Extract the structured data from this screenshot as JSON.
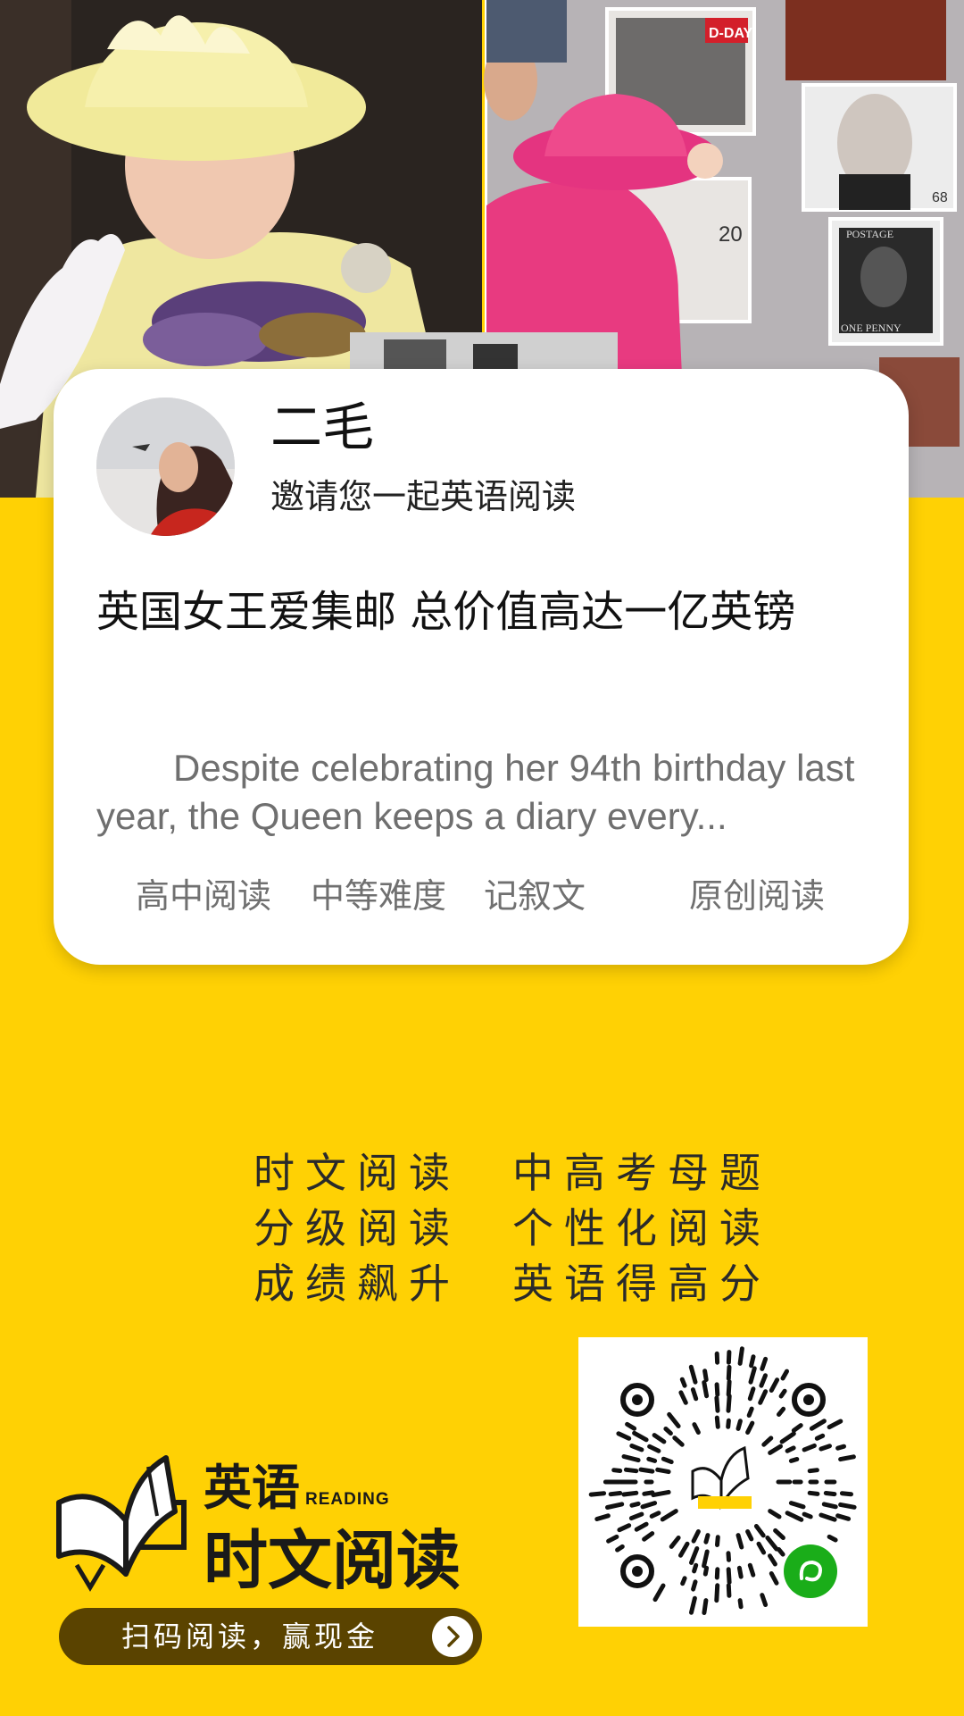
{
  "invite_card": {
    "username": "二毛",
    "invite_text": "邀请您一起英语阅读",
    "article_title": "英国女王爱集邮 总价值高达一亿英镑",
    "excerpt": "Despite celebrating her 94th birthday last year, the Queen keeps a diary every...",
    "tags": [
      "高中阅读",
      "中等难度",
      "记叙文",
      "原创阅读"
    ]
  },
  "hero_stamps": {
    "dday": "D-DAY",
    "price_20": "20",
    "price_68": "68",
    "postage": "POSTAGE",
    "one_penny": "ONE PENNY"
  },
  "slogan": {
    "line1": "时文阅读　中高考母题",
    "line2": "分级阅读　个性化阅读",
    "line3": "成绩飙升　英语得高分"
  },
  "brand": {
    "top": "英语",
    "reading": "READING",
    "main": "时文阅读"
  },
  "cta": {
    "label": "扫码阅读，赢现金"
  },
  "colors": {
    "background": "#FFD104",
    "card": "#FFFFFF",
    "cta_pill": "#5A4300",
    "wechat_green": "#1AAD19"
  }
}
